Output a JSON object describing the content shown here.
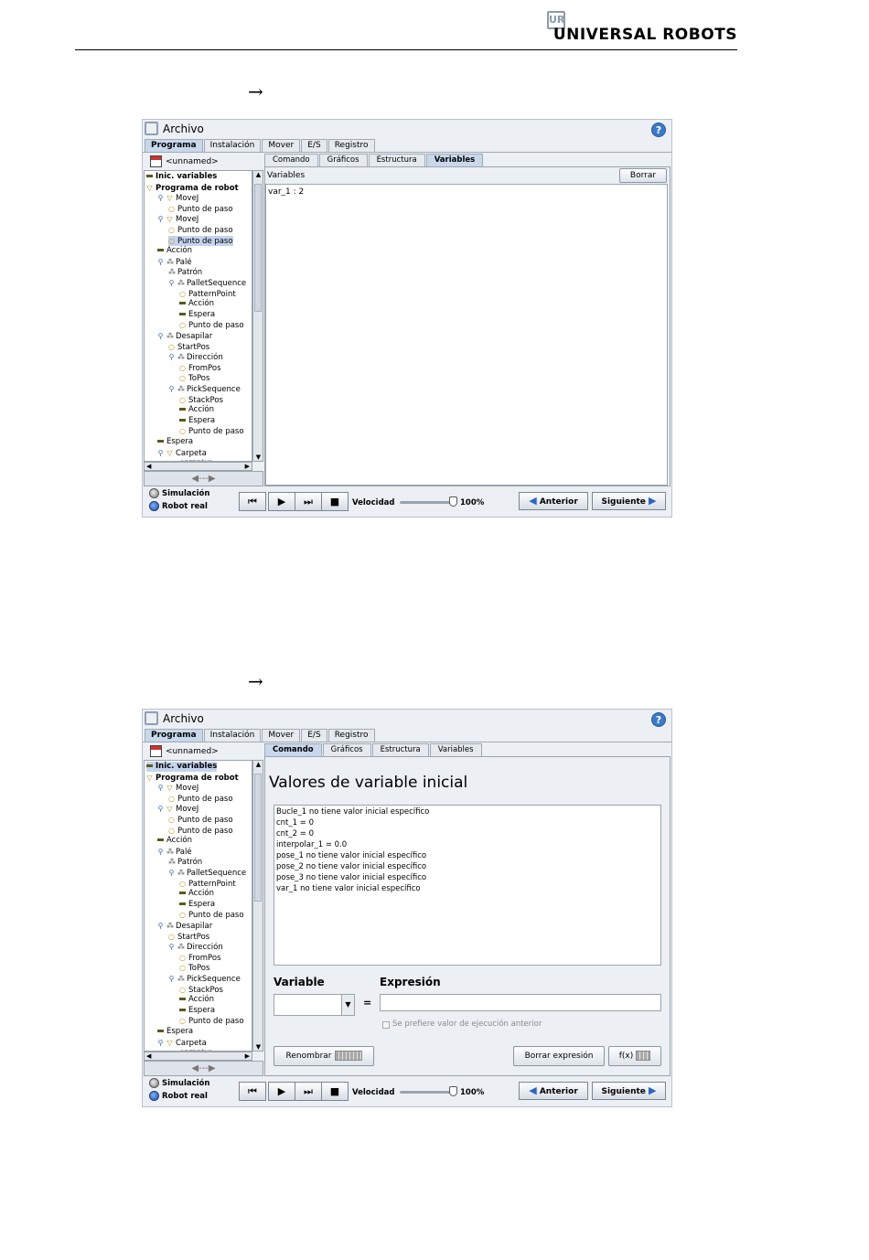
{
  "header": {
    "logo_mark": "UR",
    "logo_text": "UNIVERSAL ROBOTS"
  },
  "arrow_glyph": "→",
  "app": {
    "title": "Archivo",
    "help_glyph": "?",
    "main_tabs": [
      "Programa",
      "Instalación",
      "Mover",
      "E/S",
      "Registro"
    ],
    "file_name": "<unnamed>",
    "sub_tabs": [
      "Comando",
      "Gráficos",
      "Estructura",
      "Variables"
    ],
    "collapse_glyph": "◀---▶",
    "tree_items": [
      {
        "label": "Inic. variables",
        "icon": "bar"
      },
      {
        "label": "Programa de robot",
        "icon": "tri"
      },
      {
        "label": "MoveJ",
        "icon": "tri"
      },
      {
        "label": "Punto de paso",
        "icon": "dot"
      },
      {
        "label": "MoveJ",
        "icon": "tri"
      },
      {
        "label": "Punto de paso",
        "icon": "dot"
      },
      {
        "label": "Punto de paso",
        "icon": "dot"
      },
      {
        "label": "Acción",
        "icon": "bar"
      },
      {
        "label": "Palé",
        "icon": "pal"
      },
      {
        "label": "Patrón",
        "icon": "pal"
      },
      {
        "label": "PalletSequence",
        "icon": "pal"
      },
      {
        "label": "PatternPoint",
        "icon": "dot"
      },
      {
        "label": "Acción",
        "icon": "bar"
      },
      {
        "label": "Espera",
        "icon": "bar"
      },
      {
        "label": "Punto de paso",
        "icon": "dot"
      },
      {
        "label": "Desapilar",
        "icon": "pal"
      },
      {
        "label": "StartPos",
        "icon": "dot"
      },
      {
        "label": "Dirección",
        "icon": "pal"
      },
      {
        "label": "FromPos",
        "icon": "dot"
      },
      {
        "label": "ToPos",
        "icon": "dot"
      },
      {
        "label": "PickSequence",
        "icon": "pal"
      },
      {
        "label": "StackPos",
        "icon": "dot"
      },
      {
        "label": "Acción",
        "icon": "bar"
      },
      {
        "label": "Espera",
        "icon": "bar"
      },
      {
        "label": "Punto de paso",
        "icon": "dot"
      },
      {
        "label": "Espera",
        "icon": "bar"
      },
      {
        "label": "Carpeta",
        "icon": "tri"
      },
      {
        "label": "<empty>",
        "icon": "bar"
      }
    ],
    "bottom": {
      "simulation": "Simulación",
      "real_robot": "Robot real",
      "speed_label": "Velocidad",
      "speed_value": "100%",
      "speed_fraction": 1.0,
      "prev": "Anterior",
      "next": "Siguiente",
      "controls": [
        "⏮",
        "▶",
        "⏭",
        "■"
      ]
    }
  },
  "screen1": {
    "variables_label": "Variables",
    "clear_button": "Borrar",
    "variables": [
      "var_1 : 2"
    ]
  },
  "screen2": {
    "title": "Valores de variable inicial",
    "lines": [
      "Bucle_1 no tiene valor inicial específico",
      "cnt_1 = 0",
      "cnt_2 = 0",
      "interpolar_1 = 0.0",
      "pose_1 no tiene valor inicial específico",
      "pose_2 no tiene valor inicial específico",
      "pose_3 no tiene valor inicial específico",
      "var_1 no tiene valor inicial específico"
    ],
    "variable_label": "Variable",
    "expression_label": "Expresión",
    "equals": "=",
    "checkbox_label": "Se prefiere valor de ejecución anterior",
    "rename_button": "Renombrar",
    "clear_expression_button": "Borrar expresión",
    "f_button": "f(x)"
  }
}
